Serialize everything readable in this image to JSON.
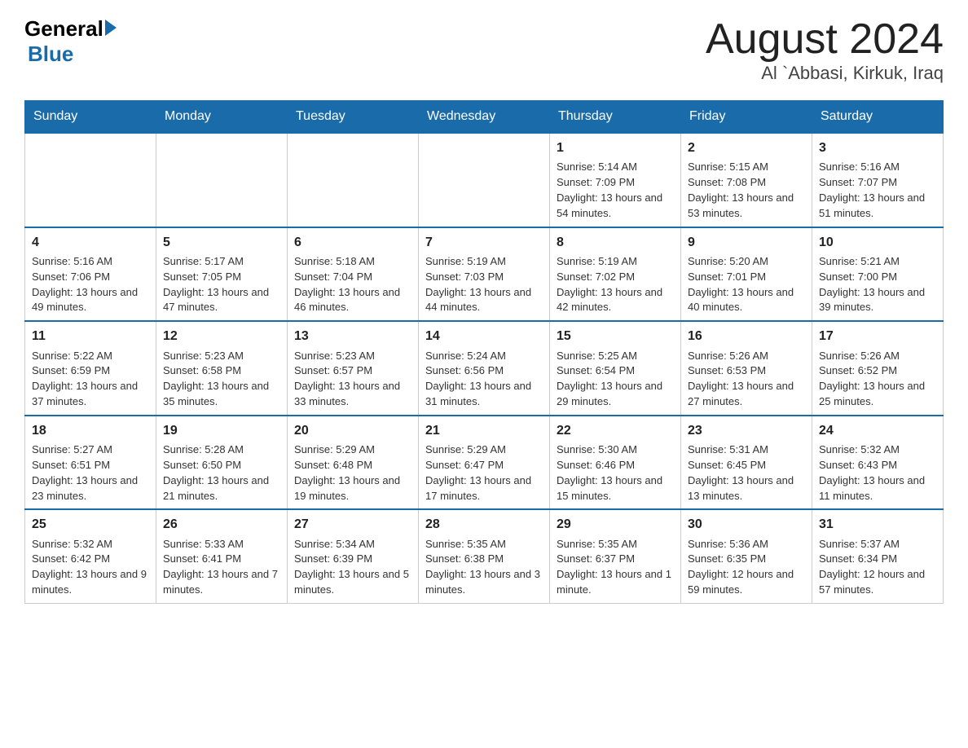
{
  "header": {
    "title": "August 2024",
    "subtitle": "Al `Abbasi, Kirkuk, Iraq",
    "logo_general": "General",
    "logo_blue": "Blue"
  },
  "days_of_week": [
    "Sunday",
    "Monday",
    "Tuesday",
    "Wednesday",
    "Thursday",
    "Friday",
    "Saturday"
  ],
  "weeks": [
    [
      {
        "day": "",
        "info": ""
      },
      {
        "day": "",
        "info": ""
      },
      {
        "day": "",
        "info": ""
      },
      {
        "day": "",
        "info": ""
      },
      {
        "day": "1",
        "info": "Sunrise: 5:14 AM\nSunset: 7:09 PM\nDaylight: 13 hours and 54 minutes."
      },
      {
        "day": "2",
        "info": "Sunrise: 5:15 AM\nSunset: 7:08 PM\nDaylight: 13 hours and 53 minutes."
      },
      {
        "day": "3",
        "info": "Sunrise: 5:16 AM\nSunset: 7:07 PM\nDaylight: 13 hours and 51 minutes."
      }
    ],
    [
      {
        "day": "4",
        "info": "Sunrise: 5:16 AM\nSunset: 7:06 PM\nDaylight: 13 hours and 49 minutes."
      },
      {
        "day": "5",
        "info": "Sunrise: 5:17 AM\nSunset: 7:05 PM\nDaylight: 13 hours and 47 minutes."
      },
      {
        "day": "6",
        "info": "Sunrise: 5:18 AM\nSunset: 7:04 PM\nDaylight: 13 hours and 46 minutes."
      },
      {
        "day": "7",
        "info": "Sunrise: 5:19 AM\nSunset: 7:03 PM\nDaylight: 13 hours and 44 minutes."
      },
      {
        "day": "8",
        "info": "Sunrise: 5:19 AM\nSunset: 7:02 PM\nDaylight: 13 hours and 42 minutes."
      },
      {
        "day": "9",
        "info": "Sunrise: 5:20 AM\nSunset: 7:01 PM\nDaylight: 13 hours and 40 minutes."
      },
      {
        "day": "10",
        "info": "Sunrise: 5:21 AM\nSunset: 7:00 PM\nDaylight: 13 hours and 39 minutes."
      }
    ],
    [
      {
        "day": "11",
        "info": "Sunrise: 5:22 AM\nSunset: 6:59 PM\nDaylight: 13 hours and 37 minutes."
      },
      {
        "day": "12",
        "info": "Sunrise: 5:23 AM\nSunset: 6:58 PM\nDaylight: 13 hours and 35 minutes."
      },
      {
        "day": "13",
        "info": "Sunrise: 5:23 AM\nSunset: 6:57 PM\nDaylight: 13 hours and 33 minutes."
      },
      {
        "day": "14",
        "info": "Sunrise: 5:24 AM\nSunset: 6:56 PM\nDaylight: 13 hours and 31 minutes."
      },
      {
        "day": "15",
        "info": "Sunrise: 5:25 AM\nSunset: 6:54 PM\nDaylight: 13 hours and 29 minutes."
      },
      {
        "day": "16",
        "info": "Sunrise: 5:26 AM\nSunset: 6:53 PM\nDaylight: 13 hours and 27 minutes."
      },
      {
        "day": "17",
        "info": "Sunrise: 5:26 AM\nSunset: 6:52 PM\nDaylight: 13 hours and 25 minutes."
      }
    ],
    [
      {
        "day": "18",
        "info": "Sunrise: 5:27 AM\nSunset: 6:51 PM\nDaylight: 13 hours and 23 minutes."
      },
      {
        "day": "19",
        "info": "Sunrise: 5:28 AM\nSunset: 6:50 PM\nDaylight: 13 hours and 21 minutes."
      },
      {
        "day": "20",
        "info": "Sunrise: 5:29 AM\nSunset: 6:48 PM\nDaylight: 13 hours and 19 minutes."
      },
      {
        "day": "21",
        "info": "Sunrise: 5:29 AM\nSunset: 6:47 PM\nDaylight: 13 hours and 17 minutes."
      },
      {
        "day": "22",
        "info": "Sunrise: 5:30 AM\nSunset: 6:46 PM\nDaylight: 13 hours and 15 minutes."
      },
      {
        "day": "23",
        "info": "Sunrise: 5:31 AM\nSunset: 6:45 PM\nDaylight: 13 hours and 13 minutes."
      },
      {
        "day": "24",
        "info": "Sunrise: 5:32 AM\nSunset: 6:43 PM\nDaylight: 13 hours and 11 minutes."
      }
    ],
    [
      {
        "day": "25",
        "info": "Sunrise: 5:32 AM\nSunset: 6:42 PM\nDaylight: 13 hours and 9 minutes."
      },
      {
        "day": "26",
        "info": "Sunrise: 5:33 AM\nSunset: 6:41 PM\nDaylight: 13 hours and 7 minutes."
      },
      {
        "day": "27",
        "info": "Sunrise: 5:34 AM\nSunset: 6:39 PM\nDaylight: 13 hours and 5 minutes."
      },
      {
        "day": "28",
        "info": "Sunrise: 5:35 AM\nSunset: 6:38 PM\nDaylight: 13 hours and 3 minutes."
      },
      {
        "day": "29",
        "info": "Sunrise: 5:35 AM\nSunset: 6:37 PM\nDaylight: 13 hours and 1 minute."
      },
      {
        "day": "30",
        "info": "Sunrise: 5:36 AM\nSunset: 6:35 PM\nDaylight: 12 hours and 59 minutes."
      },
      {
        "day": "31",
        "info": "Sunrise: 5:37 AM\nSunset: 6:34 PM\nDaylight: 12 hours and 57 minutes."
      }
    ]
  ]
}
